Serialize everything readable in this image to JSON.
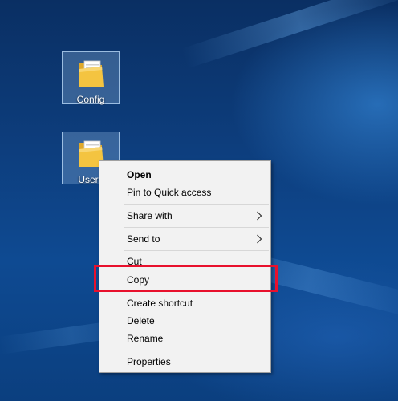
{
  "desktop": {
    "icons": [
      {
        "label": "Config",
        "icon": "folder-icon"
      },
      {
        "label": "Users",
        "icon": "folder-icon"
      }
    ],
    "colors": {
      "background": "#0d3d7c",
      "icon_selection": "#aacdf0",
      "folder": "#f4c440"
    }
  },
  "context_menu": {
    "open": "Open",
    "pin_to_quick_access": "Pin to Quick access",
    "share_with": "Share with",
    "send_to": "Send to",
    "cut": "Cut",
    "copy": "Copy",
    "create_shortcut": "Create shortcut",
    "delete": "Delete",
    "rename": "Rename",
    "properties": "Properties",
    "submenu_icon": "chevron-right-icon"
  },
  "highlight": {
    "target": "Copy",
    "color": "#e8112d"
  }
}
